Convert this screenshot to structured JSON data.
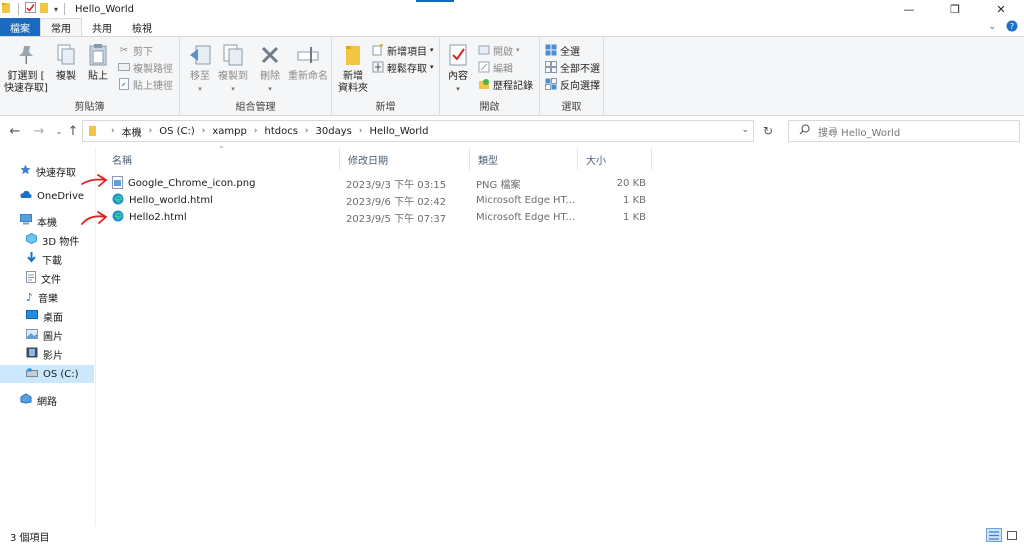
{
  "window": {
    "title": "Hello_World"
  },
  "tabs": {
    "file": "檔案",
    "home": "常用",
    "share": "共用",
    "view": "檢視"
  },
  "ribbon": {
    "pin_quick_access": "釘選到 [ 快速存取]",
    "copy": "複製",
    "paste": "貼上",
    "cut": "剪下",
    "copy_path": "複製路徑",
    "paste_shortcut": "貼上捷徑",
    "group_clipboard": "剪貼簿",
    "move_to": "移至",
    "copy_to": "複製到",
    "delete": "刪除",
    "rename": "重新命名",
    "group_organize": "組合管理",
    "new_folder": "新增 資料夾",
    "new_item": "新增項目",
    "easy_access": "輕鬆存取",
    "group_new": "新增",
    "properties": "內容",
    "open": "開啟",
    "edit": "編輯",
    "history": "歷程記錄",
    "group_open": "開啟",
    "select_all": "全選",
    "select_none": "全部不選",
    "invert_selection": "反向選擇",
    "group_select": "選取"
  },
  "address": {
    "crumbs": [
      "本機",
      "OS (C:)",
      "xampp",
      "htdocs",
      "30days",
      "Hello_World"
    ]
  },
  "search": {
    "placeholder": "搜尋 Hello_World"
  },
  "sidebar": {
    "items": [
      {
        "label": "快速存取",
        "icon": "star-icon"
      },
      {
        "label": "OneDrive",
        "icon": "cloud-icon"
      },
      {
        "label": "本機",
        "icon": "computer-icon"
      },
      {
        "label": "3D 物件",
        "icon": "cube-icon"
      },
      {
        "label": "下載",
        "icon": "download-icon"
      },
      {
        "label": "文件",
        "icon": "document-icon"
      },
      {
        "label": "音樂",
        "icon": "music-icon"
      },
      {
        "label": "桌面",
        "icon": "desktop-icon"
      },
      {
        "label": "圖片",
        "icon": "pictures-icon"
      },
      {
        "label": "影片",
        "icon": "video-icon"
      },
      {
        "label": "OS (C:)",
        "icon": "drive-icon"
      },
      {
        "label": "網路",
        "icon": "network-icon"
      }
    ]
  },
  "columns": {
    "name": "名稱",
    "modified": "修改日期",
    "type": "類型",
    "size": "大小"
  },
  "files": [
    {
      "name": "Google_Chrome_icon.png",
      "modified": "2023/9/3 下午 03:15",
      "type": "PNG 檔案",
      "size": "20 KB",
      "icon": "image-file-icon"
    },
    {
      "name": "Hello_world.html",
      "modified": "2023/9/6 下午 02:42",
      "type": "Microsoft Edge HT...",
      "size": "1 KB",
      "icon": "edge-icon"
    },
    {
      "name": "Hello2.html",
      "modified": "2023/9/5 下午 07:37",
      "type": "Microsoft Edge HT...",
      "size": "1 KB",
      "icon": "edge-icon"
    }
  ],
  "status": {
    "item_count": "3 個項目"
  },
  "colors": {
    "file_tab": "#1a6bbf",
    "selection": "#cce8ff",
    "annotation": "#e02020"
  }
}
